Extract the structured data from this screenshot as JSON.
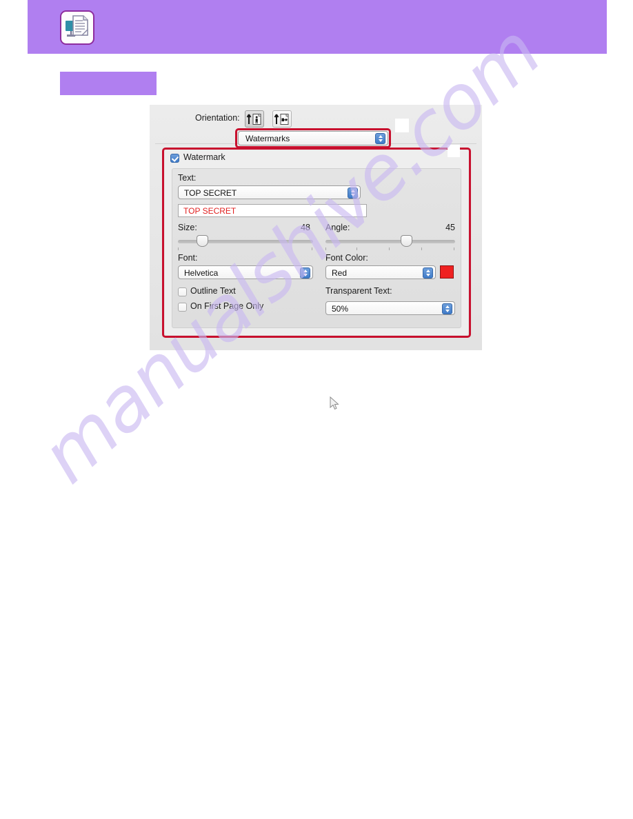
{
  "header": {
    "icon_name": "printer-document-icon",
    "band_color": "#b07ff0",
    "caption_text": ""
  },
  "page_watermark": {
    "text": "manualshive.com",
    "color": "#c9b8f2"
  },
  "dialog": {
    "orientation": {
      "label": "Orientation:",
      "options": [
        {
          "name": "portrait",
          "selected": true
        },
        {
          "name": "landscape",
          "selected": false
        }
      ]
    },
    "pane_selector": {
      "value": "Watermarks"
    },
    "watermark_checkbox": {
      "label": "Watermark",
      "checked": true
    },
    "text_field": {
      "label": "Text:",
      "dropdown_value": "TOP SECRET",
      "preview_value": "TOP SECRET",
      "preview_color": "#e02020"
    },
    "size": {
      "label": "Size:",
      "value": "48",
      "thumb_percent": 18
    },
    "angle": {
      "label": "Angle:",
      "value": "45",
      "thumb_percent": 62
    },
    "font": {
      "label": "Font:",
      "value": "Helvetica"
    },
    "font_color": {
      "label": "Font Color:",
      "value": "Red",
      "swatch": "#ef2121"
    },
    "outline_text": {
      "label": "Outline Text",
      "checked": false
    },
    "on_first_page_only": {
      "label": "On First Page Only",
      "checked": false
    },
    "transparent_text": {
      "label": "Transparent Text:",
      "value": "50%"
    },
    "highlight_color": "#c8102e"
  }
}
